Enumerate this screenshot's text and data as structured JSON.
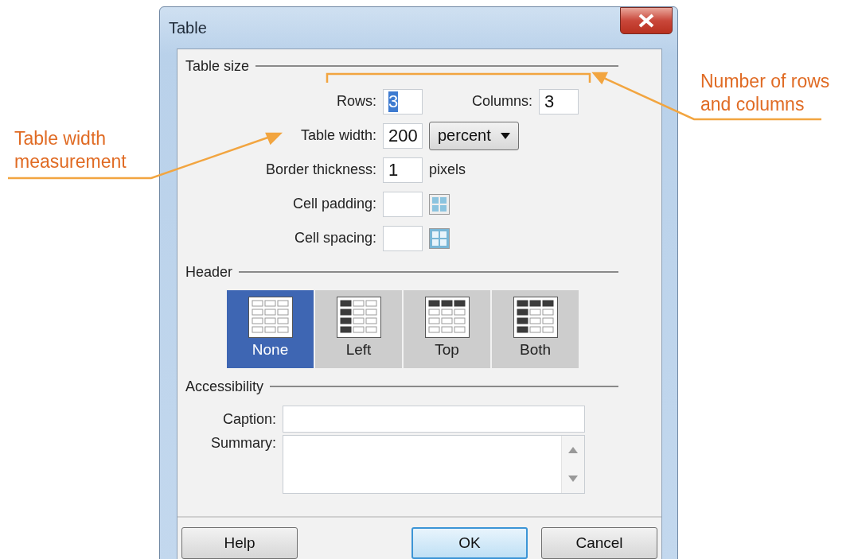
{
  "window": {
    "title": "Table"
  },
  "table_size": {
    "title": "Table size",
    "rows": {
      "label": "Rows:",
      "value": "3",
      "highlighted": true
    },
    "columns": {
      "label": "Columns:",
      "value": "3",
      "highlighted": false
    },
    "table_width": {
      "label": "Table width:",
      "value": "200",
      "unit": "percent"
    },
    "border_thickness": {
      "label": "Border thickness:",
      "value": "1",
      "unit": "pixels"
    },
    "cell_padding": {
      "label": "Cell padding:"
    },
    "cell_spacing": {
      "label": "Cell spacing:"
    }
  },
  "header": {
    "title": "Header",
    "options": [
      {
        "label": "None",
        "kind": "none",
        "selected": true
      },
      {
        "label": "Left",
        "kind": "left",
        "selected": false
      },
      {
        "label": "Top",
        "kind": "top",
        "selected": false
      },
      {
        "label": "Both",
        "kind": "both",
        "selected": false
      }
    ]
  },
  "accessibility": {
    "title": "Accessibility",
    "caption": {
      "label": "Caption:"
    },
    "summary": {
      "label": "Summary:"
    }
  },
  "buttons": [
    {
      "label": "Help",
      "default": false
    },
    {
      "label": "OK",
      "default": true
    },
    {
      "label": "Cancel",
      "default": false
    }
  ],
  "annotations": [
    {
      "text": "Table width\nmeasurement"
    },
    {
      "text": "Number of rows\nand columns"
    }
  ]
}
